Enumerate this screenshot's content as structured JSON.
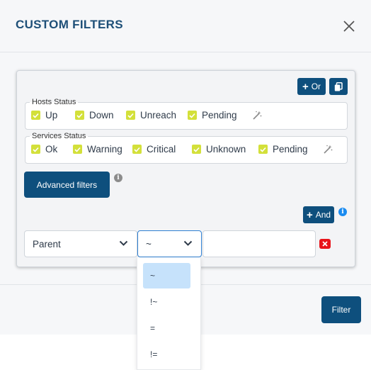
{
  "modal": {
    "title": "CUSTOM FILTERS"
  },
  "toolbar": {
    "or_label": "Or",
    "and_label": "And"
  },
  "hosts_status": {
    "legend": "Hosts Status",
    "items": [
      {
        "label": "Up",
        "checked": true
      },
      {
        "label": "Down",
        "checked": true
      },
      {
        "label": "Unreach",
        "checked": true
      },
      {
        "label": "Pending",
        "checked": true
      }
    ]
  },
  "services_status": {
    "legend": "Services Status",
    "items": [
      {
        "label": "Ok",
        "checked": true
      },
      {
        "label": "Warning",
        "checked": true
      },
      {
        "label": "Critical",
        "checked": true
      },
      {
        "label": "Unknown",
        "checked": true
      },
      {
        "label": "Pending",
        "checked": true
      }
    ]
  },
  "advanced": {
    "button_label": "Advanced filters"
  },
  "condition": {
    "field_value": "Parent",
    "operator_value": "~",
    "input_value": ""
  },
  "operator_options": [
    "~",
    "!~",
    "=",
    "!="
  ],
  "footer": {
    "filter_label": "Filter"
  },
  "colors": {
    "primary": "#0e4f7d",
    "checkbox": "#d3e03a",
    "remove": "#e8141a",
    "selected_option": "#c6e2fb"
  },
  "icons": {
    "close": "close-icon",
    "copy": "copy-icon",
    "wand": "magic-wand-icon",
    "info": "info-icon",
    "chevron": "chevron-down-icon",
    "remove": "remove-x-icon"
  }
}
